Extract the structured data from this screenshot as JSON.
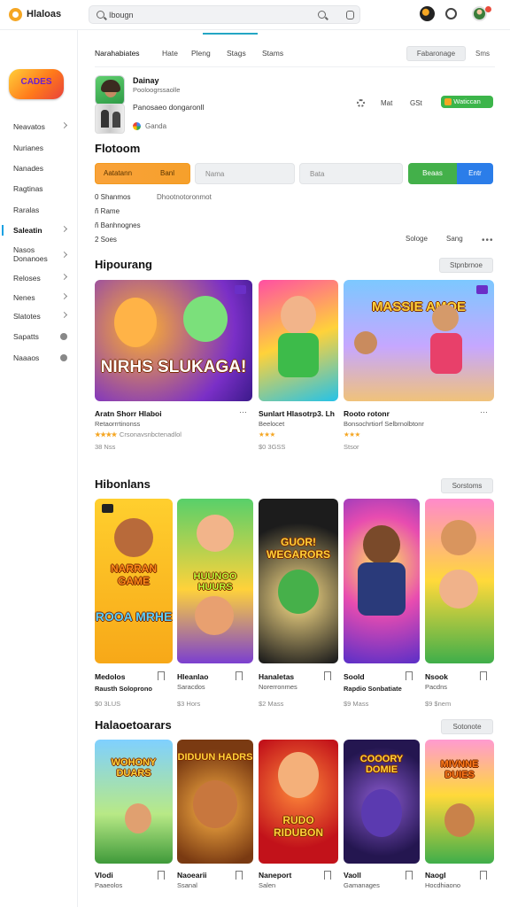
{
  "app": {
    "title": "Hlaloas"
  },
  "search": {
    "value": "Ibougn",
    "placeholder": "Ibougn"
  },
  "sidebar": {
    "logo_text": "CADES",
    "items": [
      {
        "label": "Neavatos",
        "marker": "chevron"
      },
      {
        "label": "Nurianes",
        "marker": ""
      },
      {
        "label": "Nanades",
        "marker": ""
      },
      {
        "label": "Ragtinas",
        "marker": ""
      },
      {
        "label": "Raralas",
        "marker": ""
      },
      {
        "label": "Saleatin",
        "marker": "chevron",
        "active": true
      },
      {
        "label": "Nasos\nDonanoes",
        "marker": "chevron"
      },
      {
        "label": "Reloses",
        "marker": "chevron"
      },
      {
        "label": "Nenes",
        "marker": "chevron"
      },
      {
        "label": "Slatotes",
        "marker": "chevron"
      },
      {
        "label": "Sapatts",
        "marker": "dot"
      },
      {
        "label": "Naaaos",
        "marker": "dot"
      }
    ]
  },
  "tabs": [
    "Narahabiates",
    "Hate",
    "Pleng",
    "Stags",
    "Stams"
  ],
  "header_actions": {
    "button": "Fabaronage",
    "link": "Sms"
  },
  "profile": {
    "name": "Dainay",
    "sub": "Pooloogrssaolle",
    "desc": "Panosaeo dongaronll",
    "meta": "Ganda",
    "stat1": "Mat",
    "stat2": "GSt",
    "pill": "Waticcan"
  },
  "form_section": {
    "title": "Flotoom",
    "orange_left": "Aatatann",
    "orange_right": "Banl",
    "field1": "Nama",
    "field2": "Bata",
    "btn_green": "Beaas",
    "btn_blue": "Entr",
    "lines": [
      "0 Shanmos",
      "ñ  Rame",
      "ñ  Banhnognes",
      "2  Soes"
    ],
    "info": "Dhootnotoronmot",
    "right1": "Sologe",
    "right2": "Sang",
    "more": "•••"
  },
  "sections": [
    {
      "title": "Hipourang",
      "action": "Stpnbrnoe",
      "cards": [
        {
          "art_title": "NIRHS SLUKAGA!",
          "name": "Aratn Shorr Hlaboi",
          "dev": "Retaorrrtinonss",
          "stars": "★★★★",
          "rating": "Crsonavsnbctenadlol",
          "price": "38 Nss"
        },
        {
          "art_title": "",
          "name": "Sunlart Hlasotrp3. Lh",
          "dev": "Beelocet",
          "stars": "★★★",
          "rating": "",
          "price": "$0 3GSS"
        },
        {
          "art_title": "MASSIE AMOE",
          "name": "Rooto rotonr",
          "dev": "Bonsochrtiorf Selbrnolbtonr",
          "stars": "★★★",
          "rating": "",
          "price": "Stsor"
        }
      ]
    },
    {
      "title": "Hibonlans",
      "action": "Sorstoms",
      "cards": [
        {
          "art_title": "NARRAN GAME",
          "art_title2": "ROOA MRHE",
          "name": "Medolos",
          "dev": "Rausth Soloprono",
          "price": "$0 3LUS"
        },
        {
          "art_title": "HUUNOO HUURS",
          "name": "Hleanlao",
          "dev": "Saracdos",
          "price": "$3 Hors"
        },
        {
          "art_title": "GUOR! WEGARORS",
          "name": "Hanaletas",
          "dev": "Norerronmes",
          "price": "$2 Mass"
        },
        {
          "art_title": "",
          "name": "Soold",
          "dev": "Rapdio Sonbatiate",
          "price": "$9 Mass"
        },
        {
          "art_title": "",
          "name": "Nsook",
          "dev": "Pacdns",
          "price": "$9 $nem"
        }
      ]
    },
    {
      "title": "Halaoetoarars",
      "action": "Sotonote",
      "cards": [
        {
          "art_title": "WOHONY DUARS",
          "name": "Vlodi",
          "dev": "Paaeolos",
          "price": ""
        },
        {
          "art_title": "DIDUUN HADRS",
          "name": "Naoearii",
          "dev": "Ssanal",
          "price": ""
        },
        {
          "art_title": "RUDO RIDUBON",
          "name": "Naneport",
          "dev": "Salen",
          "price": ""
        },
        {
          "art_title": "COOORY DOMIE",
          "name": "Vaoll",
          "dev": "Gamanages",
          "price": ""
        },
        {
          "art_title": "MIVNNE DUIES",
          "name": "Naogl",
          "dev": "Hocdhiaono",
          "price": ""
        }
      ]
    }
  ],
  "colors": {
    "accent": "#24a6c4",
    "orange": "#f6a02b",
    "green": "#43b04a",
    "blue": "#2b7de9"
  }
}
